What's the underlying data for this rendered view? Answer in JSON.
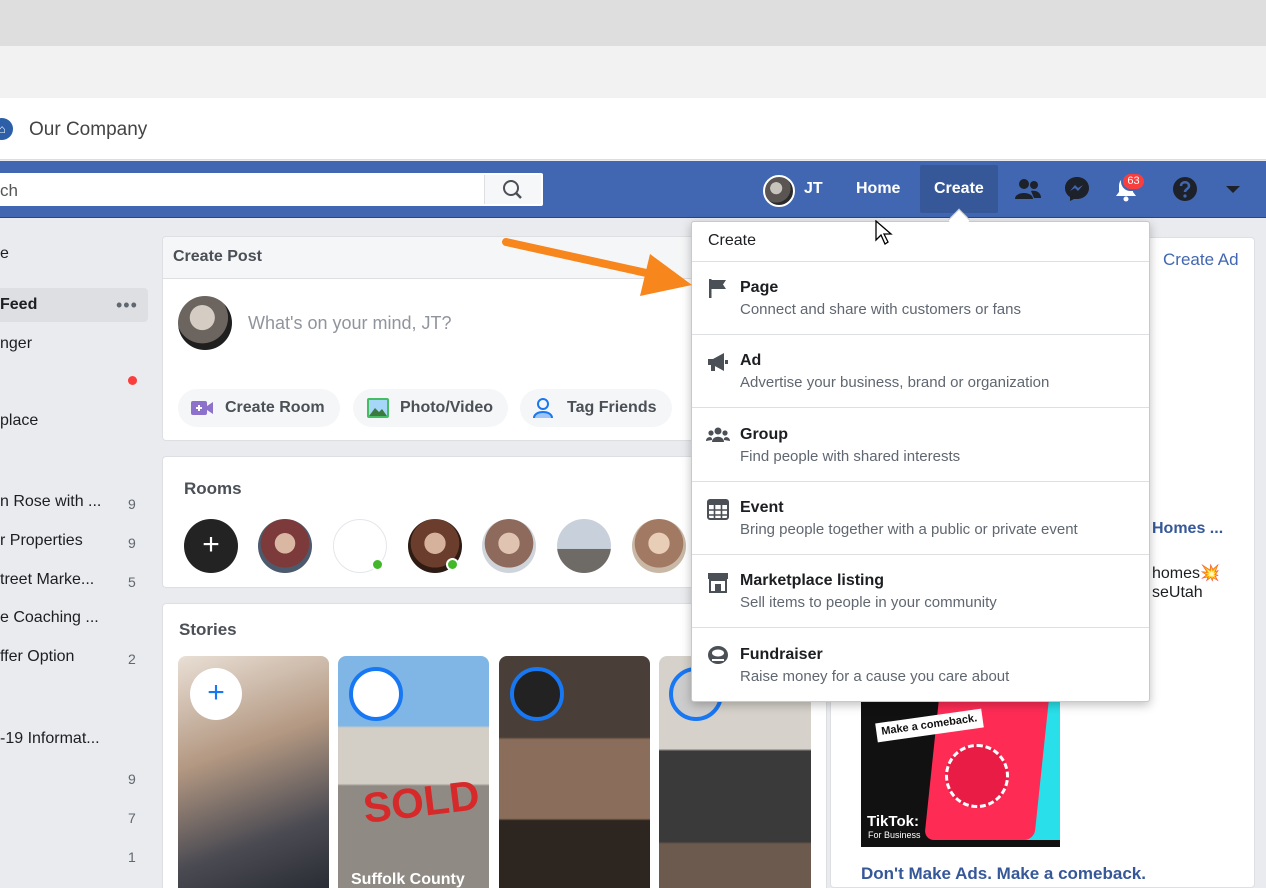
{
  "bookmarks": {
    "label": "Our Company"
  },
  "search": {
    "value": "ch"
  },
  "nav": {
    "user_name": "JT",
    "home_label": "Home",
    "create_label": "Create",
    "notification_count": "63",
    "icons": [
      "friends-icon",
      "messenger-icon",
      "bell-icon",
      "help-icon",
      "caret-down-icon"
    ]
  },
  "sidebar": {
    "items": [
      {
        "label": "e",
        "count": ""
      },
      {
        "label": "Feed",
        "count": ""
      },
      {
        "label": "nger",
        "count": ""
      },
      {
        "label": "",
        "count": ""
      },
      {
        "label": "place",
        "count": ""
      },
      {
        "label": "n Rose with ...",
        "count": "9"
      },
      {
        "label": "r Properties",
        "count": "9"
      },
      {
        "label": "treet Marke...",
        "count": "5"
      },
      {
        "label": "e Coaching ...",
        "count": ""
      },
      {
        "label": "ffer Option",
        "count": "2"
      },
      {
        "label": "-19 Informat...",
        "count": ""
      },
      {
        "label": "",
        "count": "9"
      },
      {
        "label": "",
        "count": "7"
      },
      {
        "label": "",
        "count": "1"
      }
    ],
    "more_dots": "•••"
  },
  "create_post": {
    "title": "Create Post",
    "placeholder": "What's on your mind, JT?",
    "actions": [
      {
        "label": "Create Room"
      },
      {
        "label": "Photo/Video"
      },
      {
        "label": "Tag Friends"
      }
    ]
  },
  "rooms": {
    "title": "Rooms",
    "plus": "+"
  },
  "stories": {
    "title": "Stories",
    "plus": "+",
    "sold_sign": "SOLD",
    "caption": "Suffolk County"
  },
  "right_column": {
    "create_ad": "Create Ad",
    "homes": "Homes ...",
    "line1": "homes💥",
    "line2": "seUtah",
    "ad": {
      "note": "Make a comeback.",
      "brand": "TikTok:",
      "brand_sub": "For Business",
      "title": "Don't Make Ads. Make a comeback."
    }
  },
  "create_menu": {
    "header": "Create",
    "items": [
      {
        "title": "Page",
        "desc": "Connect and share with customers or fans",
        "icon": "flag-icon"
      },
      {
        "title": "Ad",
        "desc": "Advertise your business, brand or organization",
        "icon": "megaphone-icon"
      },
      {
        "title": "Group",
        "desc": "Find people with shared interests",
        "icon": "group-icon"
      },
      {
        "title": "Event",
        "desc": "Bring people together with a public or private event",
        "icon": "calendar-icon"
      },
      {
        "title": "Marketplace listing",
        "desc": "Sell items to people in your community",
        "icon": "shop-icon"
      },
      {
        "title": "Fundraiser",
        "desc": "Raise money for a cause you care about",
        "icon": "fundraiser-icon"
      }
    ]
  },
  "colors": {
    "nav_blue": "#4267b2",
    "link_blue": "#365899",
    "annotation_orange": "#f7861c",
    "badge_red": "#fa3e3e"
  }
}
